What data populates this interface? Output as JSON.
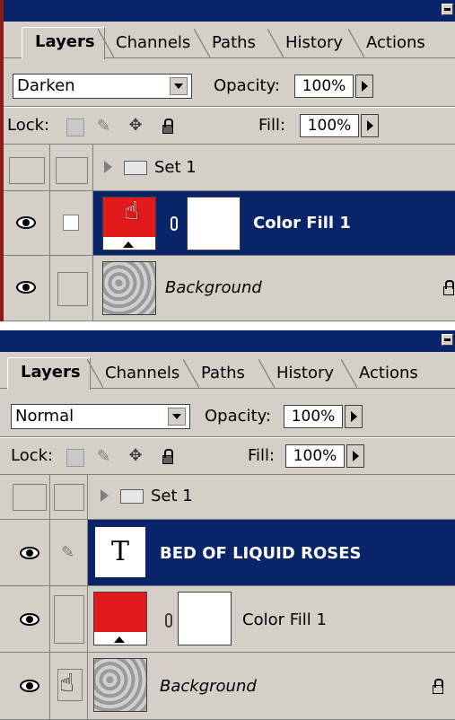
{
  "panels": [
    {
      "tabs": [
        "Layers",
        "Channels",
        "Paths",
        "History",
        "Actions"
      ],
      "blend_mode": "Darken",
      "opacity_label": "Opacity:",
      "opacity_value": "100%",
      "lock_label": "Lock:",
      "fill_label": "Fill:",
      "fill_value": "100%",
      "layers": [
        {
          "name": "Set 1",
          "type": "set"
        },
        {
          "name": "Color Fill 1",
          "type": "colorfill",
          "selected": true
        },
        {
          "name": "Background",
          "type": "background"
        }
      ]
    },
    {
      "tabs": [
        "Layers",
        "Channels",
        "Paths",
        "History",
        "Actions"
      ],
      "blend_mode": "Normal",
      "opacity_label": "Opacity:",
      "opacity_value": "100%",
      "lock_label": "Lock:",
      "fill_label": "Fill:",
      "fill_value": "100%",
      "layers": [
        {
          "name": "Set 1",
          "type": "set"
        },
        {
          "name": "BED OF LIQUID ROSES",
          "type": "text",
          "selected": true
        },
        {
          "name": "Color Fill 1",
          "type": "colorfill"
        },
        {
          "name": "Background",
          "type": "background"
        }
      ]
    }
  ],
  "colors": {
    "selection": "#0a246a",
    "fill_red": "#e11b1b",
    "panel_bg": "#d4d0c8"
  },
  "icons": [
    "eye-icon",
    "mask-link-icon",
    "lock-icon",
    "folder-icon",
    "hand-cursor-icon",
    "brush-icon",
    "move-icon",
    "transparency-lock-icon"
  ]
}
